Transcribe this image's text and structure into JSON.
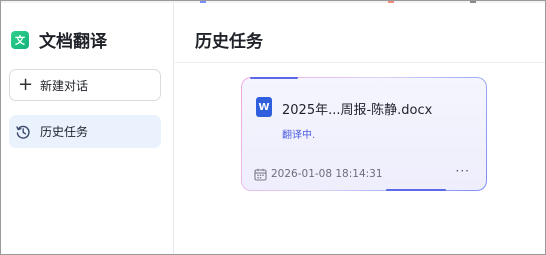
{
  "sidebar": {
    "brand_logo_text": "文",
    "brand_title": "文档翻译",
    "new_chat_label": "新建对话",
    "new_chat_icon": "plus-icon",
    "history_label": "历史任务",
    "history_icon": "history-icon"
  },
  "main": {
    "title": "历史任务",
    "tasks": [
      {
        "file_icon_text": "W",
        "file_icon": "word-doc-icon",
        "filename": "2025年...周报-陈静.docx",
        "status": "翻译中.",
        "timestamp": "2026-01-08 18:14:31",
        "more_label": "···"
      }
    ]
  },
  "colors": {
    "accent": "#4a5be0",
    "brand_green": "#14b27a",
    "history_active_bg": "#e9f2fd",
    "word_blue": "#2f5fdc"
  }
}
